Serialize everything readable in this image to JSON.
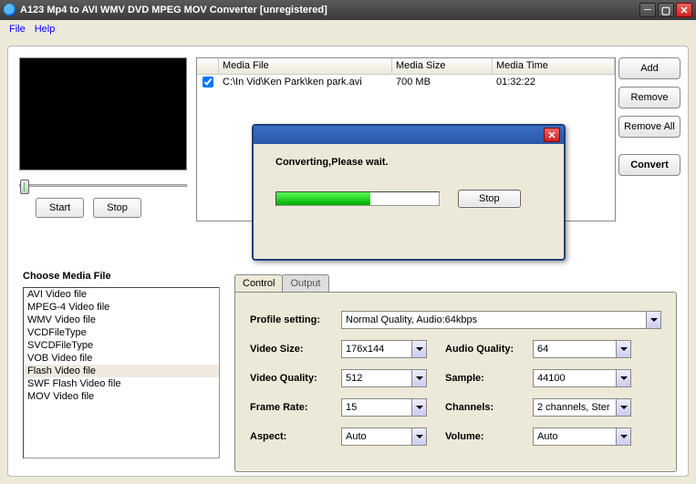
{
  "window": {
    "title": "A123 Mp4  to AVI WMV DVD MPEG MOV Converter  [unregistered]"
  },
  "menu": {
    "file": "File",
    "help": "Help"
  },
  "preview": {
    "start": "Start",
    "stop": "Stop"
  },
  "table": {
    "headers": {
      "media_file": "Media File",
      "media_size": "Media Size",
      "media_time": "Media Time"
    },
    "rows": [
      {
        "checked": true,
        "file": "C:\\In Vid\\Ken Park\\ken park.avi",
        "size": "700 MB",
        "time": "01:32:22"
      }
    ]
  },
  "actions": {
    "add": "Add",
    "remove": "Remove",
    "remove_all": "Remove All",
    "convert": "Convert"
  },
  "choose": {
    "label": "Choose Media File",
    "items": [
      "AVI Video file",
      "MPEG-4 Video file",
      "WMV Video file",
      "VCDFileType",
      "SVCDFileType",
      "VOB Video file",
      "Flash Video file",
      "SWF Flash Video file",
      "MOV Video file"
    ],
    "selected_index": 6
  },
  "tabs": {
    "control": "Control",
    "output": "Output"
  },
  "settings": {
    "profile_label": "Profile setting:",
    "profile_value": "Normal Quality, Audio:64kbps",
    "video_size_label": "Video Size:",
    "video_size_value": "176x144",
    "video_quality_label": "Video Quality:",
    "video_quality_value": "512",
    "frame_rate_label": "Frame Rate:",
    "frame_rate_value": "15",
    "aspect_label": "Aspect:",
    "aspect_value": "Auto",
    "audio_quality_label": "Audio Quality:",
    "audio_quality_value": "64",
    "sample_label": "Sample:",
    "sample_value": "44100",
    "channels_label": "Channels:",
    "channels_value": "2 channels, Ster",
    "volume_label": "Volume:",
    "volume_value": "Auto"
  },
  "dialog": {
    "message": "Converting,Please wait.",
    "stop": "Stop",
    "progress_pct": 58
  }
}
